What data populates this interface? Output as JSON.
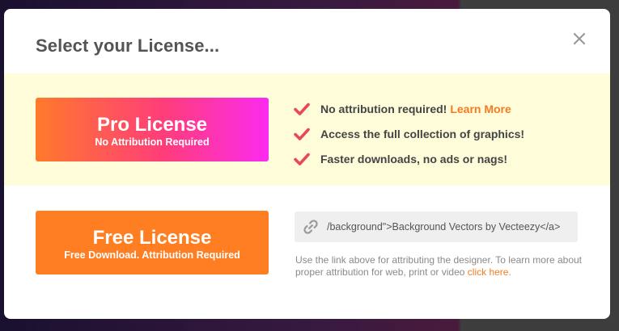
{
  "dialog": {
    "title": "Select your License...",
    "close_icon": "close-icon"
  },
  "pro": {
    "title": "Pro License",
    "subtitle": "No Attribution Required",
    "gradient": [
      "#ff7a2b",
      "#fb2bf0"
    ],
    "band_color": "#fefcd9",
    "features": [
      {
        "text": "No attribution required!",
        "link": "Learn More"
      },
      {
        "text": "Access the full collection of graphics!"
      },
      {
        "text": "Faster downloads, no ads or nags!"
      }
    ]
  },
  "free": {
    "title": "Free License",
    "subtitle": "Free Download. Attribution Required",
    "color": "#ff7e22",
    "attribution_code": "/background\">Background Vectors by Vecteezy</a>",
    "note_text": "Use the link above for attributing the designer. To learn more about proper attribution for web, print or video ",
    "note_link": "click here."
  },
  "colors": {
    "accent": "#f47b20",
    "check": "#e8495a",
    "text": "#444444"
  }
}
